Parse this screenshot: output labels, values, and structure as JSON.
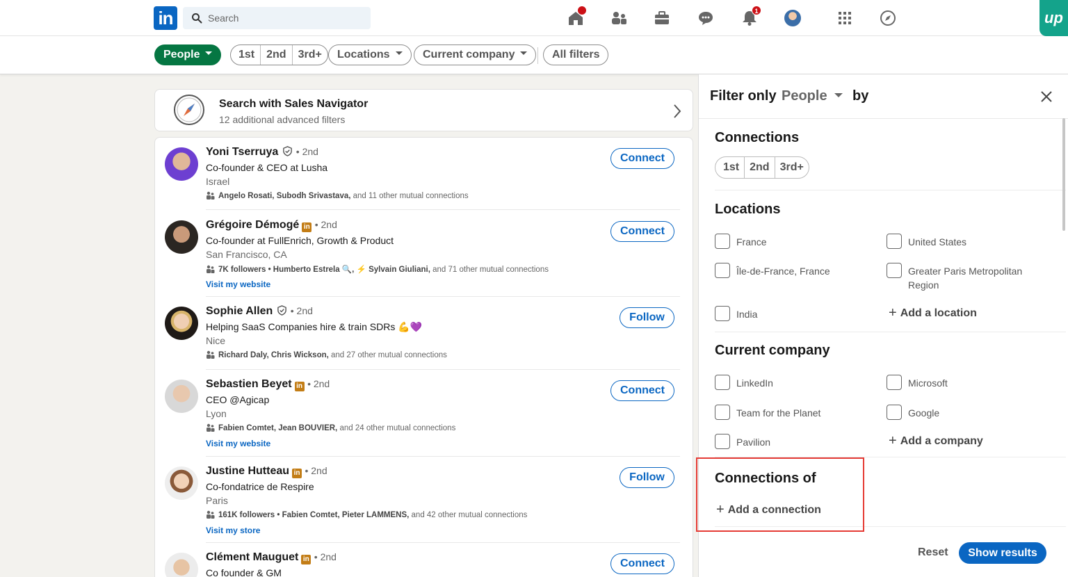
{
  "nav": {
    "logo": "in",
    "search_placeholder": "Search",
    "messaging_badge": "",
    "notifications_badge": "1",
    "extension_label": "up",
    "accent": "#0a66c2"
  },
  "filterbar": {
    "people": "People",
    "degrees": [
      "1st",
      "2nd",
      "3rd+"
    ],
    "locations": "Locations",
    "current_company": "Current company",
    "all_filters": "All filters"
  },
  "salesnav": {
    "title": "Search with Sales Navigator",
    "subtitle": "12 additional advanced filters"
  },
  "results": [
    {
      "name": "Yoni Tserruya",
      "badge": "verified",
      "degree": "• 2nd",
      "title": "Co-founder & CEO at Lusha",
      "location": "Israel",
      "mutual_names": "Angelo Rosati, Subodh Srivastava,",
      "mutual_rest": "and 11 other mutual connections",
      "link": "",
      "action": "Connect"
    },
    {
      "name": "Grégoire Démogé",
      "badge": "linkedin",
      "degree": "• 2nd",
      "title": "Co-founder at FullEnrich, Growth & Product",
      "location": "San Francisco, CA",
      "mutual_names": "7K followers • Humberto Estrela 🔍, ⚡ Sylvain Giuliani,",
      "mutual_rest": "and 71 other mutual connections",
      "link": "Visit my website",
      "action": "Connect"
    },
    {
      "name": "Sophie Allen",
      "badge": "verified",
      "degree": "• 2nd",
      "title": "Helping SaaS Companies hire & train SDRs 💪💜",
      "location": "Nice",
      "mutual_names": "Richard Daly, Chris Wickson,",
      "mutual_rest": "and 27 other mutual connections",
      "link": "",
      "action": "Follow"
    },
    {
      "name": "Sebastien Beyet",
      "badge": "linkedin",
      "degree": "• 2nd",
      "title": "CEO @Agicap",
      "location": "Lyon",
      "mutual_names": "Fabien Comtet, Jean BOUVIER,",
      "mutual_rest": "and 24 other mutual connections",
      "link": "Visit my website",
      "action": "Connect"
    },
    {
      "name": "Justine Hutteau",
      "badge": "linkedin",
      "degree": "• 2nd",
      "title": "Co-fondatrice de Respire",
      "location": "Paris",
      "mutual_names": "161K followers • Fabien Comtet, Pieter LAMMENS,",
      "mutual_rest": "and 42 other mutual connections",
      "link": "Visit my store",
      "action": "Follow"
    },
    {
      "name": "Clément Mauguet",
      "badge": "linkedin",
      "degree": "• 2nd",
      "title": "Co founder & GM",
      "location": "",
      "mutual_names": "",
      "mutual_rest": "",
      "link": "",
      "action": "Connect"
    }
  ],
  "panel": {
    "filter_only": "Filter only",
    "type": "People",
    "by": "by",
    "connections_title": "Connections",
    "degrees": [
      "1st",
      "2nd",
      "3rd+"
    ],
    "locations_title": "Locations",
    "locations": [
      "France",
      "United States",
      "Île-de-France, France",
      "Greater Paris Metropolitan Region",
      "India"
    ],
    "add_location": "Add a location",
    "company_title": "Current company",
    "companies": [
      "LinkedIn",
      "Microsoft",
      "Team for the Planet",
      "Google",
      "Pavilion"
    ],
    "add_company": "Add a company",
    "connections_of_title": "Connections of",
    "add_connection": "Add a connection",
    "reset": "Reset",
    "show_results": "Show results"
  }
}
